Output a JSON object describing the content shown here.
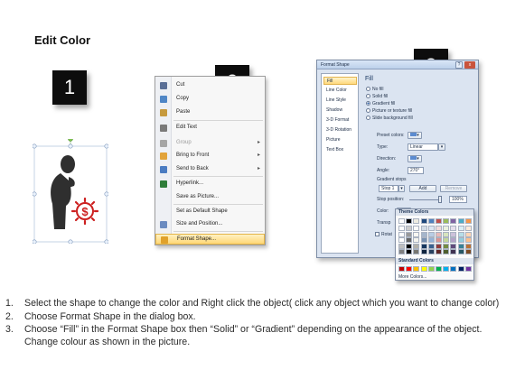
{
  "title": "Edit Color",
  "step_numbers": [
    "1",
    "2",
    "3"
  ],
  "context_menu": {
    "items": [
      {
        "label": "Cut",
        "icon": "scissors-icon",
        "icon_color": "#5a6f96",
        "disabled": false,
        "submenu": false
      },
      {
        "label": "Copy",
        "icon": "copy-icon",
        "icon_color": "#4f86c6",
        "disabled": false,
        "submenu": false
      },
      {
        "label": "Paste",
        "icon": "paste-icon",
        "icon_color": "#c69a3e",
        "disabled": false,
        "submenu": false
      },
      {
        "label": "Edit Text",
        "icon": "edit-text-icon",
        "icon_color": "#7a7a7a",
        "disabled": false,
        "submenu": false
      },
      {
        "label": "Group",
        "icon": "group-icon",
        "icon_color": "#a5a5a5",
        "disabled": true,
        "submenu": true
      },
      {
        "label": "Bring to Front",
        "icon": "bring-to-front-icon",
        "icon_color": "#e2a33a",
        "disabled": false,
        "submenu": true
      },
      {
        "label": "Send to Back",
        "icon": "send-to-back-icon",
        "icon_color": "#4a7cc2",
        "disabled": false,
        "submenu": true
      },
      {
        "label": "Hyperlink...",
        "icon": "hyperlink-icon",
        "icon_color": "#2e7d3a",
        "disabled": false,
        "submenu": false
      },
      {
        "label": "Save as Picture...",
        "icon": "",
        "icon_color": "",
        "disabled": false,
        "submenu": false
      },
      {
        "label": "Set as Default Shape",
        "icon": "",
        "icon_color": "",
        "disabled": false,
        "submenu": false
      },
      {
        "label": "Size and Position...",
        "icon": "size-position-icon",
        "icon_color": "#6b8bc0",
        "disabled": false,
        "submenu": false
      },
      {
        "label": "Format Shape...",
        "icon": "format-shape-icon",
        "icon_color": "#e0a12b",
        "disabled": false,
        "submenu": false,
        "highlighted": true
      }
    ]
  },
  "dialog": {
    "title": "Format Shape",
    "close_label": "x",
    "help_label": "?",
    "nav": [
      "Fill",
      "Line Color",
      "Line Style",
      "Shadow",
      "3-D Format",
      "3-D Rotation",
      "Picture",
      "Text Box"
    ],
    "selected_nav": "Fill",
    "heading": "Fill",
    "options": [
      {
        "label": "No fill",
        "selected": false
      },
      {
        "label": "Solid fill",
        "selected": false
      },
      {
        "label": "Gradient fill",
        "selected": true
      },
      {
        "label": "Picture or texture fill",
        "selected": false
      },
      {
        "label": "Slide background fill",
        "selected": false
      }
    ],
    "preset_colors_label": "Preset colors:",
    "type_label": "Type:",
    "type_value": "Linear",
    "direction_label": "Direction:",
    "angle_label": "Angle:",
    "angle_value": "270°",
    "gradient_stops_label": "Gradient stops",
    "stop_value": "Stop 1",
    "add_label": "Add",
    "remove_label": "Remove",
    "stop_position_label": "Stop position:",
    "stop_position_value": "100%",
    "color_label": "Color:",
    "transparency_label": "Transp",
    "rotate_label": "Rotat"
  },
  "color_picker": {
    "theme_label": "Theme Colors",
    "standard_label": "Standard Colors",
    "more_label": "More Colors...",
    "theme_top_row": [
      "#ffffff",
      "#000000",
      "#eeece1",
      "#1f497d",
      "#4f81bd",
      "#c0504d",
      "#9bbb59",
      "#8064a2",
      "#4bacc6",
      "#f79646"
    ],
    "standard_row": [
      "#c00000",
      "#ff0000",
      "#ffc000",
      "#ffff00",
      "#92d050",
      "#00b050",
      "#00b0f0",
      "#0070c0",
      "#002060",
      "#7030a0"
    ]
  },
  "instructions": [
    {
      "num": "1.",
      "text": "Select the shape to change the color and Right click the object( click any object which you want to change color)"
    },
    {
      "num": "2.",
      "text": "Choose Format Shape in the dialog box."
    },
    {
      "num": "3.",
      "text": "Choose “Fill” in the Format Shape box then “Solid” or “Gradient” depending on the appearance of the object. Change colour as shown in the picture."
    }
  ]
}
